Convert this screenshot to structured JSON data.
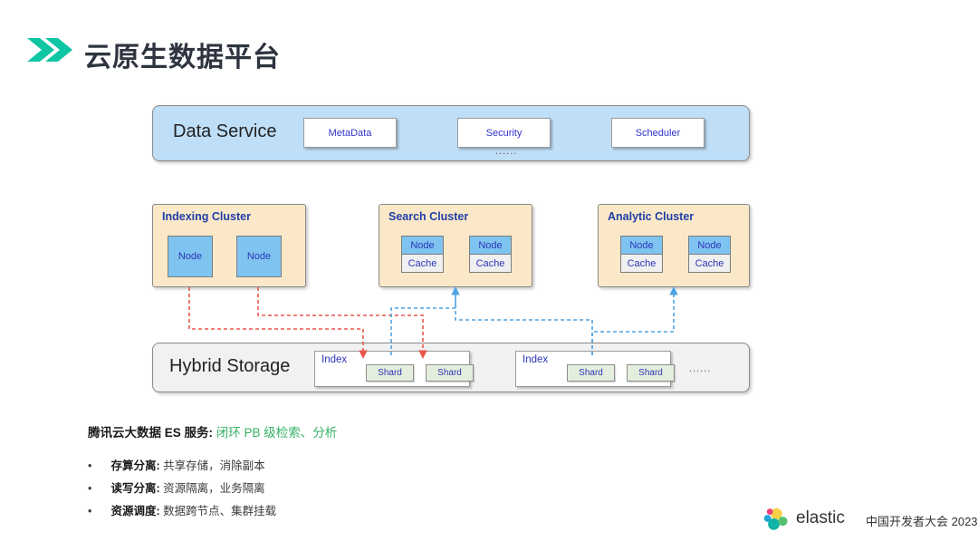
{
  "header": {
    "title": "云原生数据平台",
    "chevron_color": "#0ec5a4"
  },
  "diagram": {
    "data_service": {
      "label": "Data Service",
      "band_color": "#bfdef7",
      "services": [
        "MetaData",
        "Security",
        "Scheduler"
      ],
      "ellipsis": "......"
    },
    "clusters": [
      {
        "name": "Indexing Cluster",
        "nodes": [
          {
            "node": "Node",
            "cache": null
          },
          {
            "node": "Node",
            "cache": null
          }
        ]
      },
      {
        "name": "Search Cluster",
        "nodes": [
          {
            "node": "Node",
            "cache": "Cache"
          },
          {
            "node": "Node",
            "cache": "Cache"
          }
        ]
      },
      {
        "name": "Analytic Cluster",
        "nodes": [
          {
            "node": "Node",
            "cache": "Cache"
          },
          {
            "node": "Node",
            "cache": "Cache"
          }
        ]
      }
    ],
    "hybrid_storage": {
      "label": "Hybrid Storage",
      "band_color": "#f1f1f1",
      "indexes": [
        {
          "label": "Index",
          "shards": [
            "Shard",
            "Shard"
          ]
        },
        {
          "label": "Index",
          "shards": [
            "Shard",
            "Shard"
          ]
        }
      ],
      "ellipsis": "......"
    },
    "connector_colors": {
      "write_path": "#e8574a",
      "read_path": "#4fa3e3"
    }
  },
  "summary": {
    "lede_key": "腾讯云大数据 ES 服务:",
    "lede_value": "闭环 PB 级检索、分析",
    "bullets": [
      {
        "marker": "•",
        "key": "存算分离:",
        "value": "共享存储，消除副本"
      },
      {
        "marker": "•",
        "key": "读写分离:",
        "value": "资源隔离，业务隔离"
      },
      {
        "marker": "•",
        "key": "资源调度:",
        "value": "数据跨节点、集群挂载"
      }
    ]
  },
  "footer": {
    "brand": "elastic",
    "event": "中国开发者大会 2023"
  }
}
